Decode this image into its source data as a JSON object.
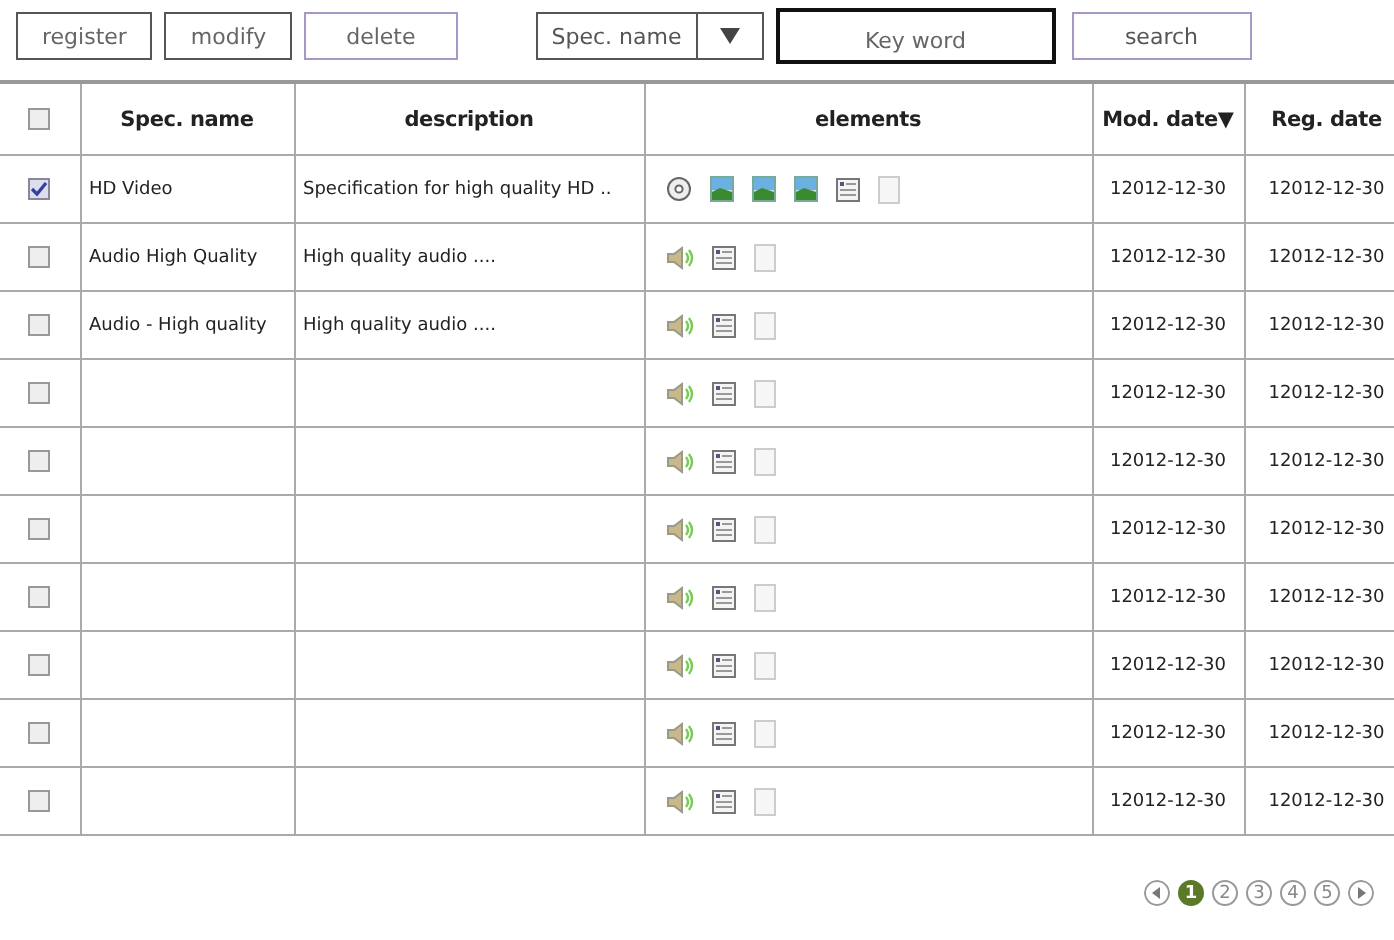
{
  "toolbar": {
    "buttons": [
      {
        "label": "register",
        "selected": false
      },
      {
        "label": "modify",
        "selected": false
      },
      {
        "label": "delete",
        "selected": true
      }
    ],
    "filter": {
      "value": "Spec. name"
    },
    "keyword": {
      "placeholder": "Key word"
    },
    "search_button": "search"
  },
  "table": {
    "columns": [
      "Spec. name",
      "description",
      "elements",
      "Mod. date▼",
      "Reg. date"
    ],
    "header_checked": false,
    "rows": [
      {
        "checked": true,
        "name": "HD Video",
        "description": "Specification for high quality HD ..",
        "elements": [
          {
            "kind": "disc"
          },
          {
            "kind": "image"
          },
          {
            "kind": "image"
          },
          {
            "kind": "image"
          },
          {
            "kind": "form"
          },
          {
            "kind": "page"
          }
        ],
        "mod_date": "12012-12-30",
        "reg_date": "12012-12-30"
      },
      {
        "checked": false,
        "name": "Audio High Quality",
        "description": "High quality audio ....",
        "elements": [
          {
            "kind": "audio"
          },
          {
            "kind": "form"
          },
          {
            "kind": "page"
          }
        ],
        "mod_date": "12012-12-30",
        "reg_date": "12012-12-30"
      },
      {
        "checked": false,
        "name": "Audio - High quality",
        "description": "High quality audio ....",
        "elements": [
          {
            "kind": "audio"
          },
          {
            "kind": "form"
          },
          {
            "kind": "page"
          }
        ],
        "mod_date": "12012-12-30",
        "reg_date": "12012-12-30"
      },
      {
        "checked": false,
        "elements": [
          {
            "kind": "audio"
          },
          {
            "kind": "form"
          },
          {
            "kind": "page"
          }
        ],
        "mod_date": "12012-12-30",
        "reg_date": "12012-12-30"
      },
      {
        "checked": false,
        "elements": [
          {
            "kind": "audio"
          },
          {
            "kind": "form"
          },
          {
            "kind": "page"
          }
        ],
        "mod_date": "12012-12-30",
        "reg_date": "12012-12-30"
      },
      {
        "checked": false,
        "elements": [
          {
            "kind": "audio"
          },
          {
            "kind": "form"
          },
          {
            "kind": "page"
          }
        ],
        "mod_date": "12012-12-30",
        "reg_date": "12012-12-30"
      },
      {
        "checked": false,
        "elements": [
          {
            "kind": "audio"
          },
          {
            "kind": "form"
          },
          {
            "kind": "page"
          }
        ],
        "mod_date": "12012-12-30",
        "reg_date": "12012-12-30"
      },
      {
        "checked": false,
        "elements": [
          {
            "kind": "audio"
          },
          {
            "kind": "form"
          },
          {
            "kind": "page"
          }
        ],
        "mod_date": "12012-12-30",
        "reg_date": "12012-12-30"
      },
      {
        "checked": false,
        "elements": [
          {
            "kind": "audio"
          },
          {
            "kind": "form"
          },
          {
            "kind": "page"
          }
        ],
        "mod_date": "12012-12-30",
        "reg_date": "12012-12-30"
      },
      {
        "checked": false,
        "elements": [
          {
            "kind": "audio"
          },
          {
            "kind": "form"
          },
          {
            "kind": "page"
          }
        ],
        "mod_date": "12012-12-30",
        "reg_date": "12012-12-30"
      }
    ]
  },
  "pagination": {
    "pages": [
      {
        "label": "1",
        "selected": true
      },
      {
        "label": "2",
        "selected": false
      },
      {
        "label": "3",
        "selected": false
      },
      {
        "label": "4",
        "selected": false
      },
      {
        "label": "5",
        "selected": false
      }
    ]
  }
}
